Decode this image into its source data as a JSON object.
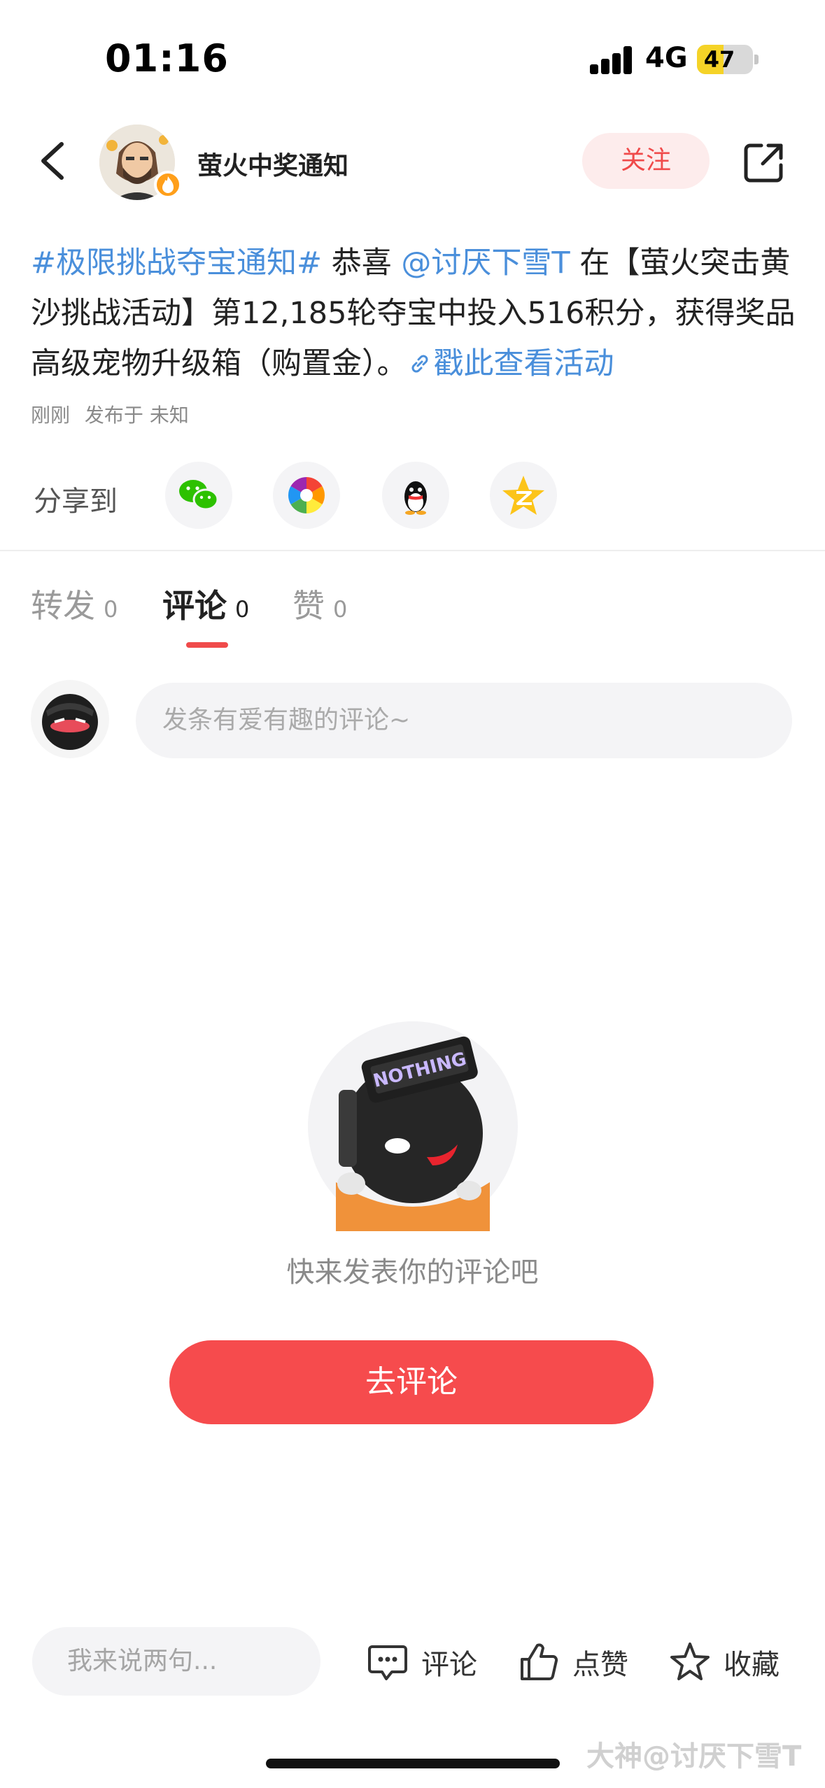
{
  "status_bar": {
    "time": "01:16",
    "network": "4G",
    "battery": "47",
    "battery_level": 0.47
  },
  "header": {
    "author_name": "萤火中奖通知",
    "follow_label": "关注"
  },
  "post": {
    "tag": "#极限挑战夺宝通知#",
    "text_1": " 恭喜 ",
    "mention": "@讨厌下雪T",
    "text_2": " 在【萤火突击黄沙挑战活动】第12,185轮夺宝中投入516积分，获得奖品高级宠物升级箱（购置金）。",
    "link_label": "戳此查看活动",
    "time": "刚刚",
    "location": "发布于 未知"
  },
  "share": {
    "label": "分享到",
    "targets": [
      "wechat-icon",
      "moments-icon",
      "qq-icon",
      "qzone-icon"
    ]
  },
  "tabs": [
    {
      "label": "转发",
      "count": "0"
    },
    {
      "label": "评论",
      "count": "0"
    },
    {
      "label": "赞",
      "count": "0"
    }
  ],
  "comment": {
    "placeholder": "发条有爱有趣的评论~"
  },
  "empty_state": {
    "text": "快来发表你的评论吧",
    "button_label": "去评论",
    "badge_text": "NOTHING"
  },
  "bottom_bar": {
    "input_placeholder": "我来说两句...",
    "comment_label": "评论",
    "like_label": "点赞",
    "favorite_label": "收藏"
  },
  "watermark": "大神@讨厌下雪T",
  "colors": {
    "accent": "#f64b4d",
    "link": "#4a8fdb"
  }
}
